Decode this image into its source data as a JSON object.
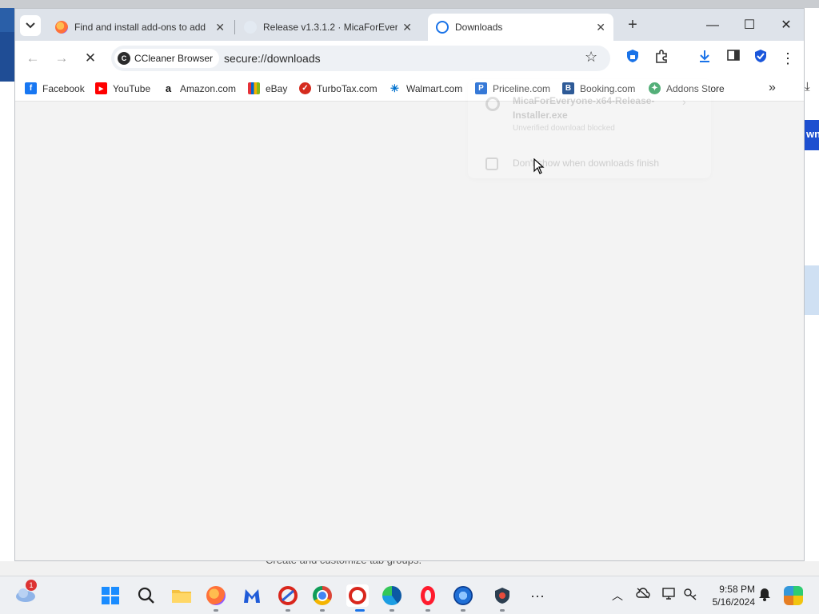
{
  "tabs": [
    {
      "title": "Find and install add-ons to add",
      "favicon": "firefox-icon",
      "active": false
    },
    {
      "title": "Release v1.3.1.2 · MicaForEveryone",
      "favicon": "github-icon",
      "active": false
    },
    {
      "title": "Downloads",
      "favicon": "download-icon",
      "active": true
    }
  ],
  "toolbar": {
    "site_chip": "CCleaner Browser",
    "url": "secure://downloads"
  },
  "bookmarks": [
    {
      "label": "Facebook",
      "icon": "facebook-icon",
      "color": "#1877f2"
    },
    {
      "label": "YouTube",
      "icon": "youtube-icon",
      "color": "#ff0000"
    },
    {
      "label": "Amazon.com",
      "icon": "amazon-icon",
      "color": "#111111"
    },
    {
      "label": "eBay",
      "icon": "ebay-icon",
      "color": "#e53238"
    },
    {
      "label": "TurboTax.com",
      "icon": "turbotax-icon",
      "color": "#d52b1e"
    },
    {
      "label": "Walmart.com",
      "icon": "walmart-icon",
      "color": "#0071ce"
    },
    {
      "label": "Priceline.com",
      "icon": "priceline-icon",
      "color": "#0a5ccf"
    },
    {
      "label": "Booking.com",
      "icon": "booking-icon",
      "color": "#003580"
    },
    {
      "label": "Addons Store",
      "icon": "addons-store-icon",
      "color": "#2e9e5b"
    }
  ],
  "popup": {
    "filename": "MicaForEveryone-x64-Release-Installer.exe",
    "status": "Unverified download blocked",
    "checkbox_label": "Don't show when downloads finish"
  },
  "background": {
    "right_button_text": "wn",
    "bottom_text": "Create and customize tab groups."
  },
  "taskbar": {
    "weather_badge": "1",
    "time": "9:58 PM",
    "date": "5/16/2024"
  }
}
